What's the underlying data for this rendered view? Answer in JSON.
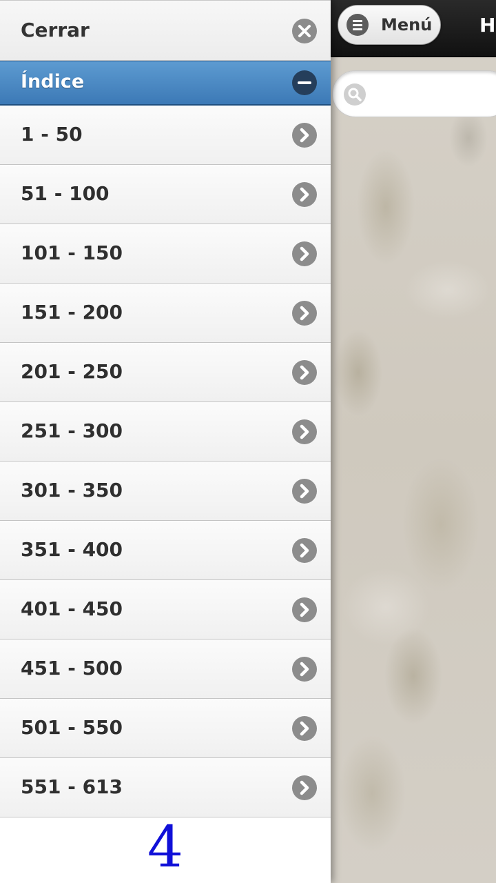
{
  "header": {
    "menu_label": "Menú",
    "title_partial": "H"
  },
  "search": {
    "placeholder": "",
    "value": ""
  },
  "panel": {
    "close_label": "Cerrar",
    "index_label": "Índice",
    "items": [
      {
        "label": "1 - 50"
      },
      {
        "label": "51 - 100"
      },
      {
        "label": "101 - 150"
      },
      {
        "label": "151 - 200"
      },
      {
        "label": "201 - 250"
      },
      {
        "label": "251 - 300"
      },
      {
        "label": "301 - 350"
      },
      {
        "label": "351 - 400"
      },
      {
        "label": "401 - 450"
      },
      {
        "label": "451 - 500"
      },
      {
        "label": "501 - 550"
      },
      {
        "label": "551 - 613"
      }
    ],
    "page_number": "4"
  },
  "colors": {
    "index_header": "#4a88c4",
    "icon_gray": "#8c8c8c",
    "page_number": "#1010d8"
  },
  "icons": {
    "close": "close-icon",
    "collapse": "minus-icon",
    "item": "chevron-right-icon",
    "menu": "hamburger-icon",
    "search": "search-icon"
  }
}
